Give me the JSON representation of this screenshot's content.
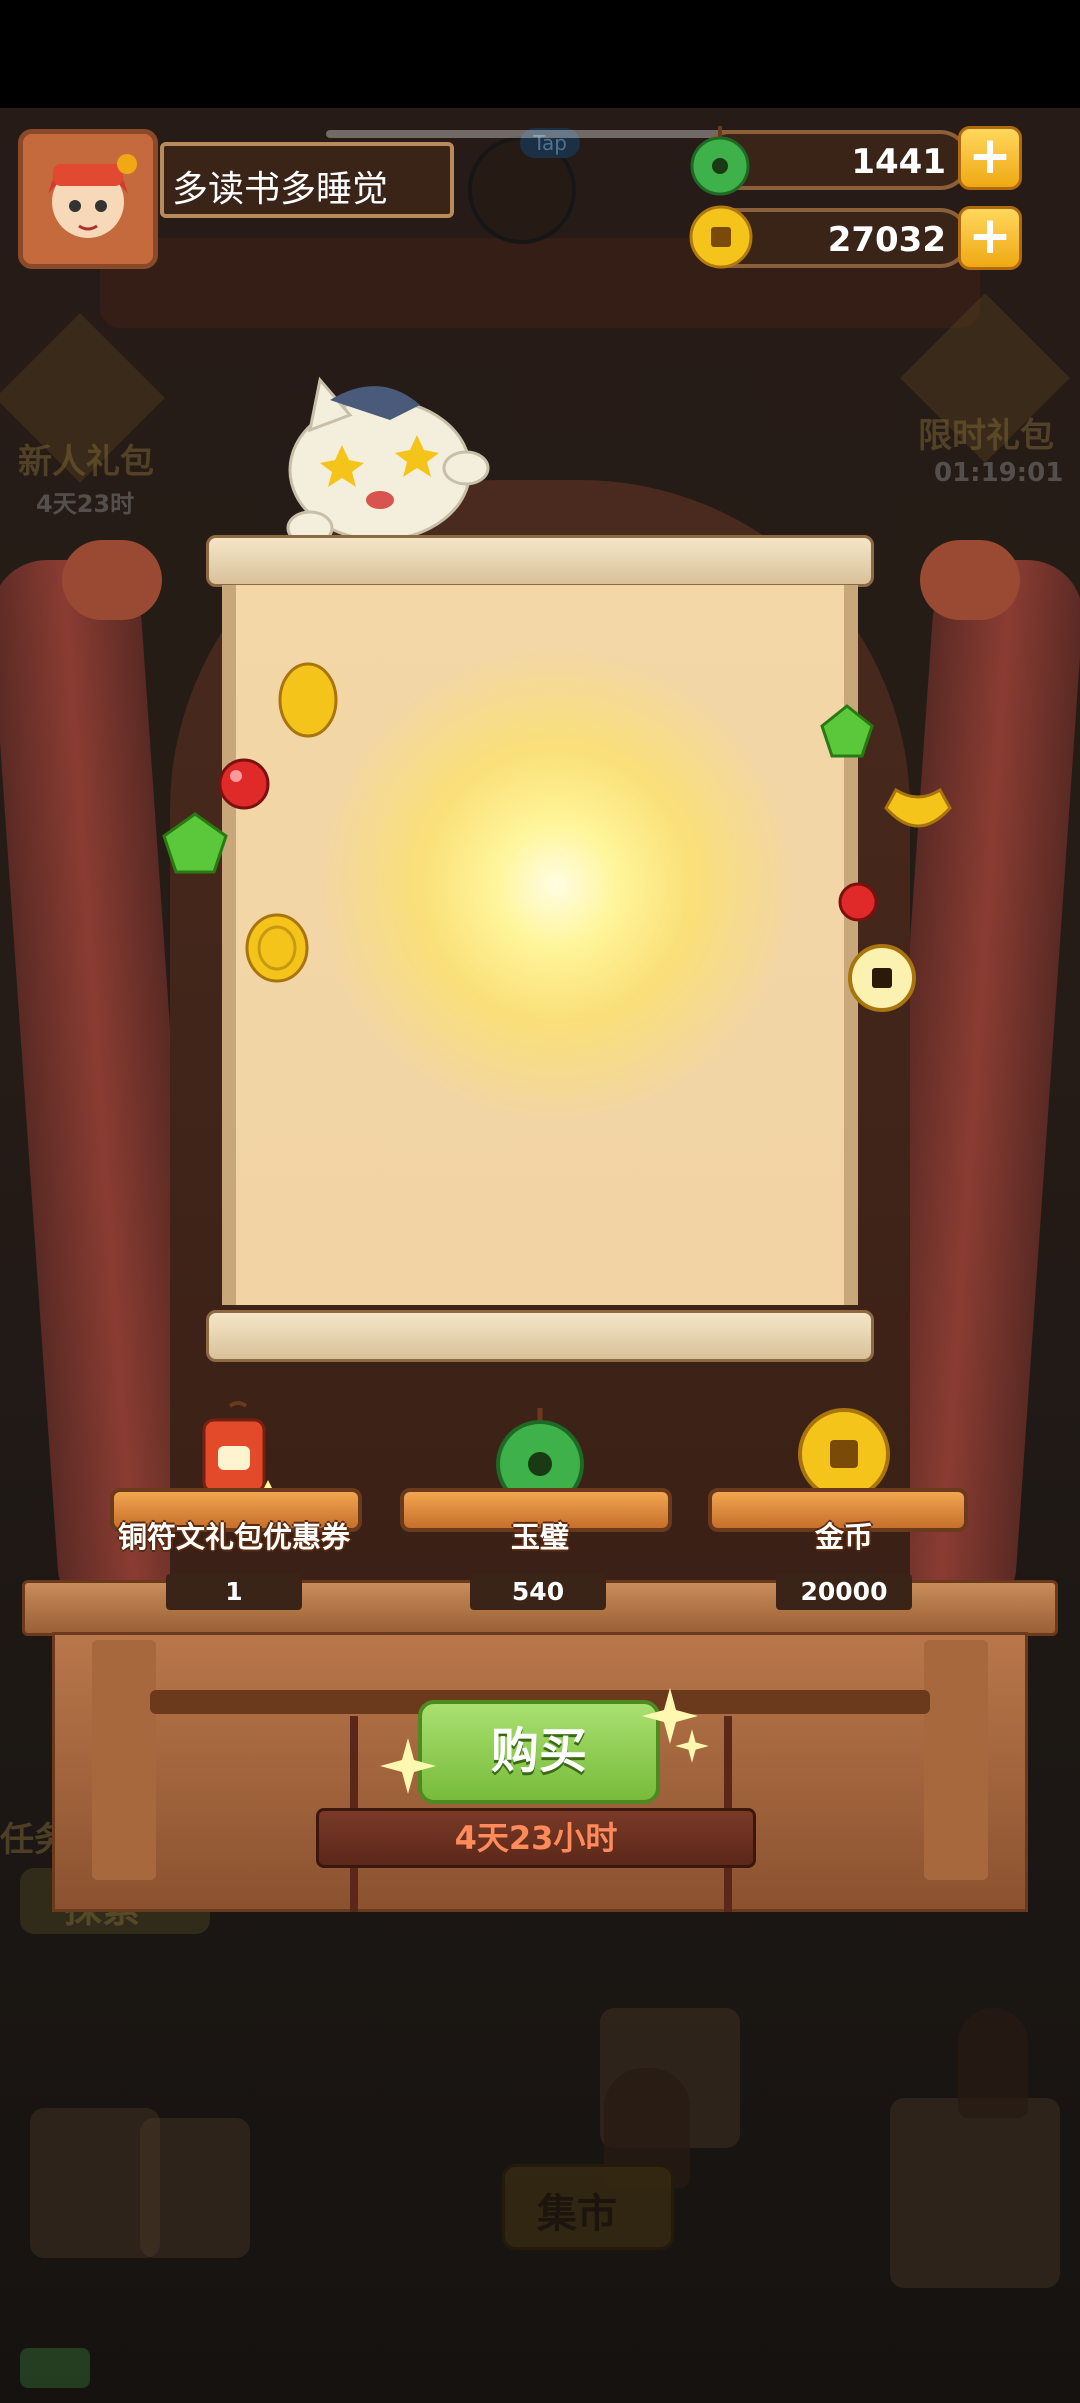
{
  "player": {
    "name": "多读书多睡觉"
  },
  "resources": {
    "jade": "1441",
    "coins": "27032"
  },
  "side_events": {
    "newbie_pack_title": "新人礼包",
    "newbie_pack_timer": "4天23时",
    "limited_pack_title": "限时礼包",
    "limited_pack_timer": "01:19:01",
    "tap_hint": "Tap"
  },
  "rewards": [
    {
      "label": "铜符文礼包优惠券",
      "qty": "1",
      "icon": "coupon-icon"
    },
    {
      "label": "玉璧",
      "qty": "540",
      "icon": "jade-disc-icon"
    },
    {
      "label": "金币",
      "qty": "20000",
      "icon": "gold-coin-icon"
    }
  ],
  "purchase": {
    "buy_label": "购买",
    "remaining": "4天23小时"
  },
  "background": {
    "task_label": "任务",
    "explore_label": "探索",
    "market_label": "集市"
  },
  "colors": {
    "accent_green": "#78bb3c",
    "gold": "#f0a814",
    "timer_text": "#ff8a5a"
  }
}
